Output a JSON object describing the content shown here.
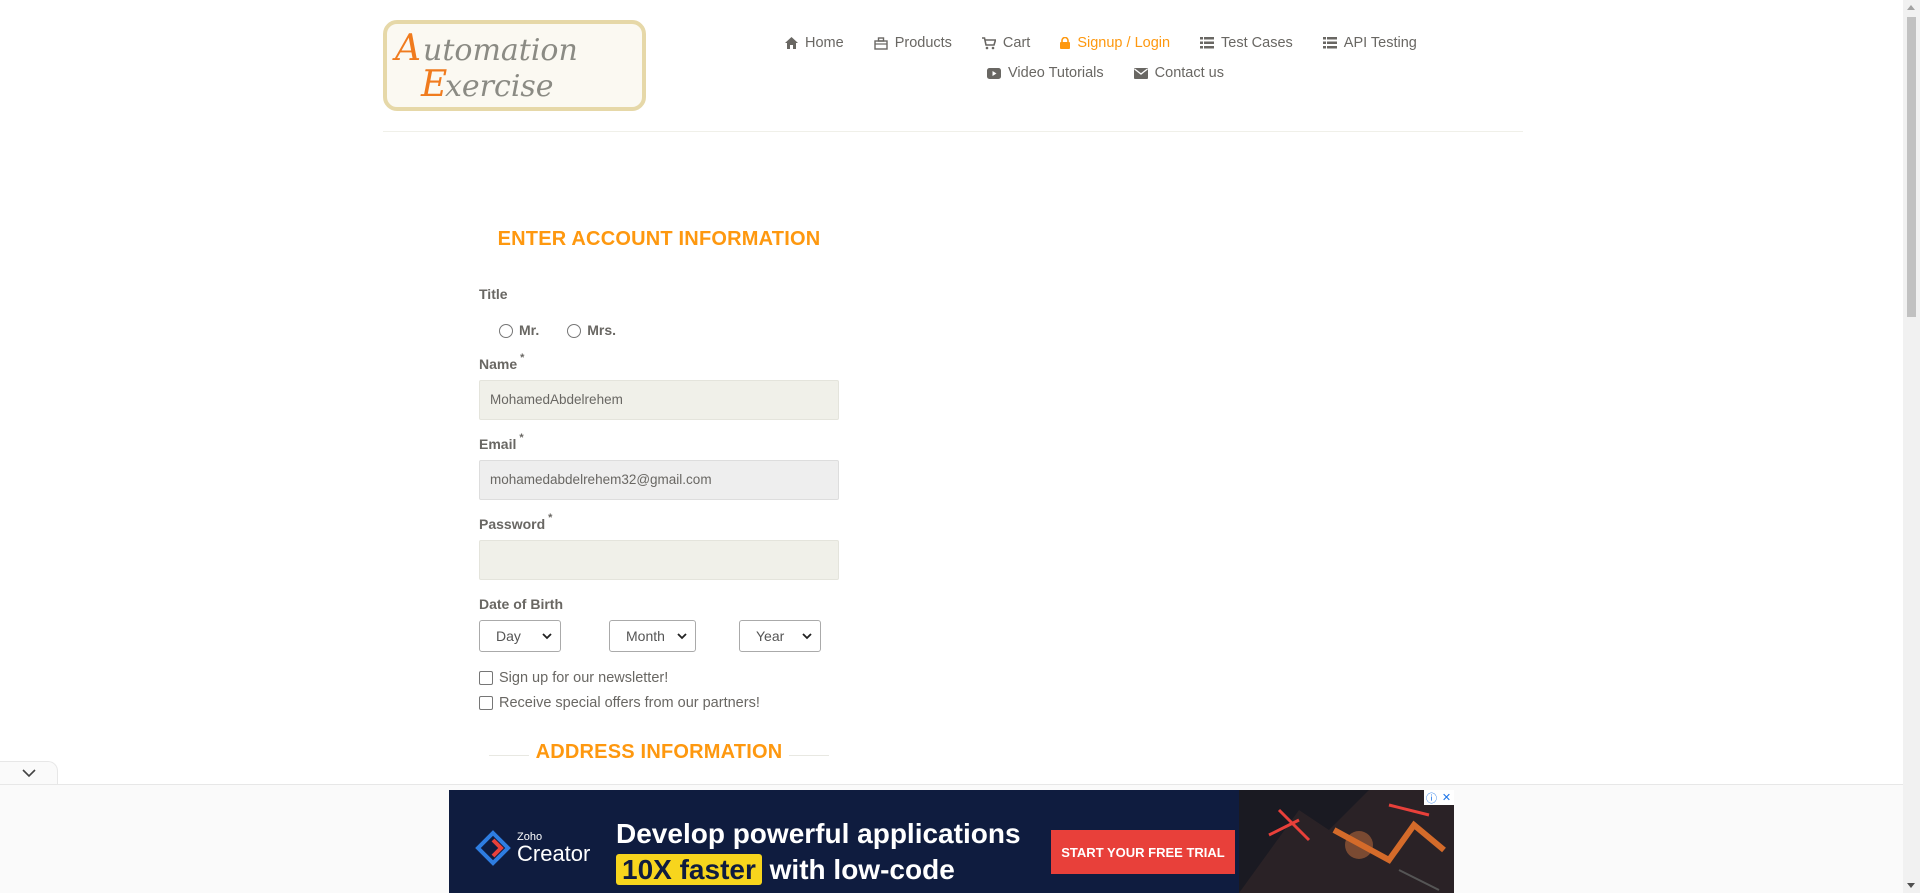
{
  "brand": {
    "logo_line1": "Automation",
    "logo_line2": "Exercise"
  },
  "nav": {
    "items": [
      {
        "label": "Home",
        "icon": "home-icon"
      },
      {
        "label": "Products",
        "icon": "products-icon"
      },
      {
        "label": "Cart",
        "icon": "cart-icon"
      },
      {
        "label": "Signup / Login",
        "icon": "lock-icon",
        "active": true
      },
      {
        "label": "Test Cases",
        "icon": "list-icon"
      },
      {
        "label": "API Testing",
        "icon": "list-icon"
      },
      {
        "label": "Video Tutorials",
        "icon": "youtube-icon"
      },
      {
        "label": "Contact us",
        "icon": "envelope-icon"
      }
    ]
  },
  "form": {
    "heading": "ENTER ACCOUNT INFORMATION",
    "title_label": "Title",
    "title_options": [
      "Mr.",
      "Mrs."
    ],
    "name_label": "Name",
    "name_value": "MohamedAbdelrehem",
    "email_label": "Email",
    "email_value": "mohamedabdelrehem32@gmail.com",
    "password_label": "Password",
    "password_value": "",
    "required_mark": "*",
    "dob_label": "Date of Birth",
    "dob_day": "Day",
    "dob_month": "Month",
    "dob_year": "Year",
    "newsletter_label": "Sign up for our newsletter!",
    "offers_label": "Receive special offers from our partners!",
    "address_heading": "ADDRESS INFORMATION"
  },
  "ad": {
    "brand_small": "Zoho",
    "brand_big": "Creator",
    "headline_line1": "Develop powerful applications",
    "headline_highlight": "10X faster",
    "headline_line2_rest": "with low-code",
    "cta": "START YOUR FREE TRIAL",
    "info_icon": "ⓘ",
    "close_icon": "✕"
  },
  "colors": {
    "accent": "#fe980f",
    "text": "#696763",
    "input_bg": "#f0f0e9",
    "ad_bg": "#0f1c3f",
    "ad_cta": "#e8403a",
    "ad_highlight": "#f7d51d"
  }
}
